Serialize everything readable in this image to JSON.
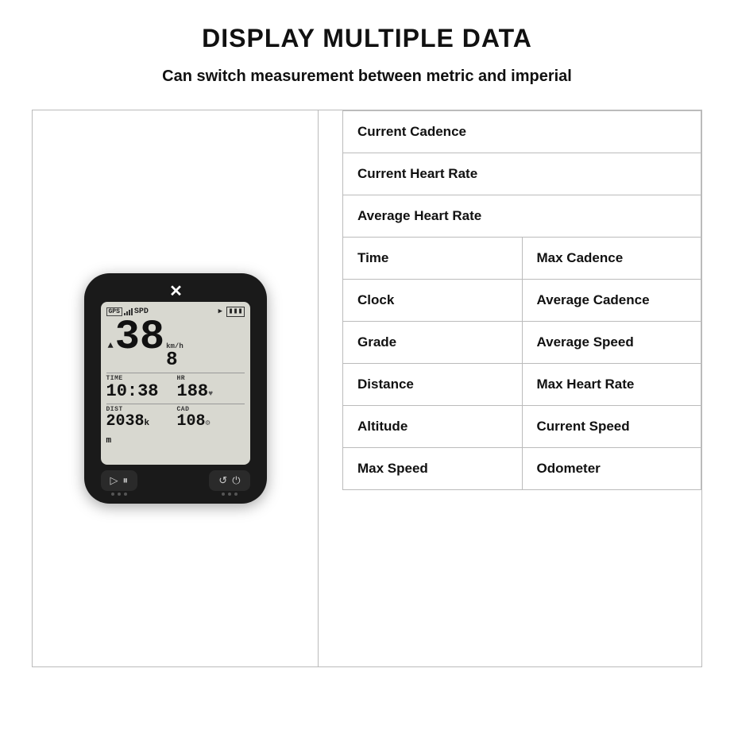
{
  "page": {
    "main_title": "DISPLAY MULTIPLE DATA",
    "subtitle": "Can switch measurement between metric and imperial"
  },
  "device": {
    "top_icon": "✕",
    "screen": {
      "gps_label": "GPS",
      "spd_label": "SPD",
      "speed_main": "38",
      "speed_sub": "8",
      "kmh_unit": "km/h",
      "time_label": "TIME",
      "time_value": "10:38",
      "hr_label": "HR",
      "hr_value": "188",
      "dist_label": "DIST",
      "dist_value": "2038",
      "dist_unit": "k m",
      "cad_label": "CAD",
      "cad_value": "108"
    },
    "buttons": {
      "play_icon": "▷",
      "pause_icon": "⏸",
      "refresh_icon": "↺",
      "power_icon": "⏻"
    }
  },
  "table": {
    "full_rows": [
      {
        "id": "current-cadence",
        "text": "Current Cadence"
      },
      {
        "id": "current-heart-rate",
        "text": "Current Heart Rate"
      },
      {
        "id": "average-heart-rate",
        "text": "Average Heart Rate"
      }
    ],
    "split_rows": [
      {
        "left_id": "time",
        "left": "Time",
        "right_id": "max-cadence",
        "right": "Max Cadence"
      },
      {
        "left_id": "clock",
        "left": "Clock",
        "right_id": "average-cadence",
        "right": "Average Cadence"
      },
      {
        "left_id": "grade",
        "left": "Grade",
        "right_id": "average-speed",
        "right": "Average Speed"
      },
      {
        "left_id": "distance",
        "left": "Distance",
        "right_id": "max-heart-rate",
        "right": "Max Heart Rate"
      },
      {
        "left_id": "altitude",
        "left": "Altitude",
        "right_id": "current-speed",
        "right": "Current Speed"
      },
      {
        "left_id": "max-speed",
        "left": "Max Speed",
        "right_id": "odometer",
        "right": "Odometer"
      }
    ]
  }
}
